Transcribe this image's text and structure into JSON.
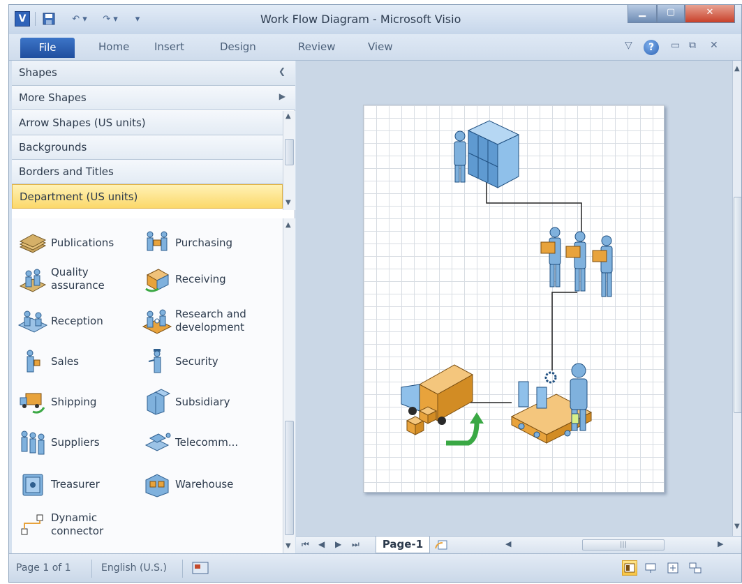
{
  "window": {
    "title": "Work Flow Diagram - Microsoft Visio",
    "app_icon_letter": "V"
  },
  "ribbon": {
    "tabs": [
      "File",
      "Home",
      "Insert",
      "Design",
      "Review",
      "View"
    ]
  },
  "shapes_panel": {
    "header": "Shapes",
    "more_shapes": "More Shapes",
    "stencils": [
      "Arrow Shapes (US units)",
      "Backgrounds",
      "Borders and Titles",
      "Department (US units)"
    ],
    "active_stencil": "Department (US units)",
    "items": [
      {
        "label": "Publications",
        "icon": "books-icon"
      },
      {
        "label": "Purchasing",
        "icon": "purchasing-icon"
      },
      {
        "label": "Quality\nassurance",
        "icon": "quality-assurance-icon"
      },
      {
        "label": "Receiving",
        "icon": "receiving-icon"
      },
      {
        "label": "Reception",
        "icon": "reception-icon"
      },
      {
        "label": "Research and\ndevelopment",
        "icon": "research-icon"
      },
      {
        "label": "Sales",
        "icon": "sales-icon"
      },
      {
        "label": "Security",
        "icon": "security-icon"
      },
      {
        "label": "Shipping",
        "icon": "shipping-icon"
      },
      {
        "label": "Subsidiary",
        "icon": "subsidiary-icon"
      },
      {
        "label": "Suppliers",
        "icon": "suppliers-icon"
      },
      {
        "label": "Telecomm...",
        "icon": "telecomm-icon"
      },
      {
        "label": "Treasurer",
        "icon": "treasurer-icon"
      },
      {
        "label": "Warehouse",
        "icon": "warehouse-icon"
      },
      {
        "label": "Dynamic\nconnector",
        "icon": "connector-icon"
      }
    ]
  },
  "page_tabs": {
    "current": "Page-1"
  },
  "status": {
    "page": "Page 1 of 1",
    "language": "English (U.S.)"
  },
  "colors": {
    "ribbon_file": "#2a5fb0",
    "active_stencil": "#fbd86a",
    "canvas": "#cad7e6",
    "shape_blue": "#7fb1dd",
    "box_orange": "#e8a33c",
    "arrow_green": "#3aa844"
  }
}
